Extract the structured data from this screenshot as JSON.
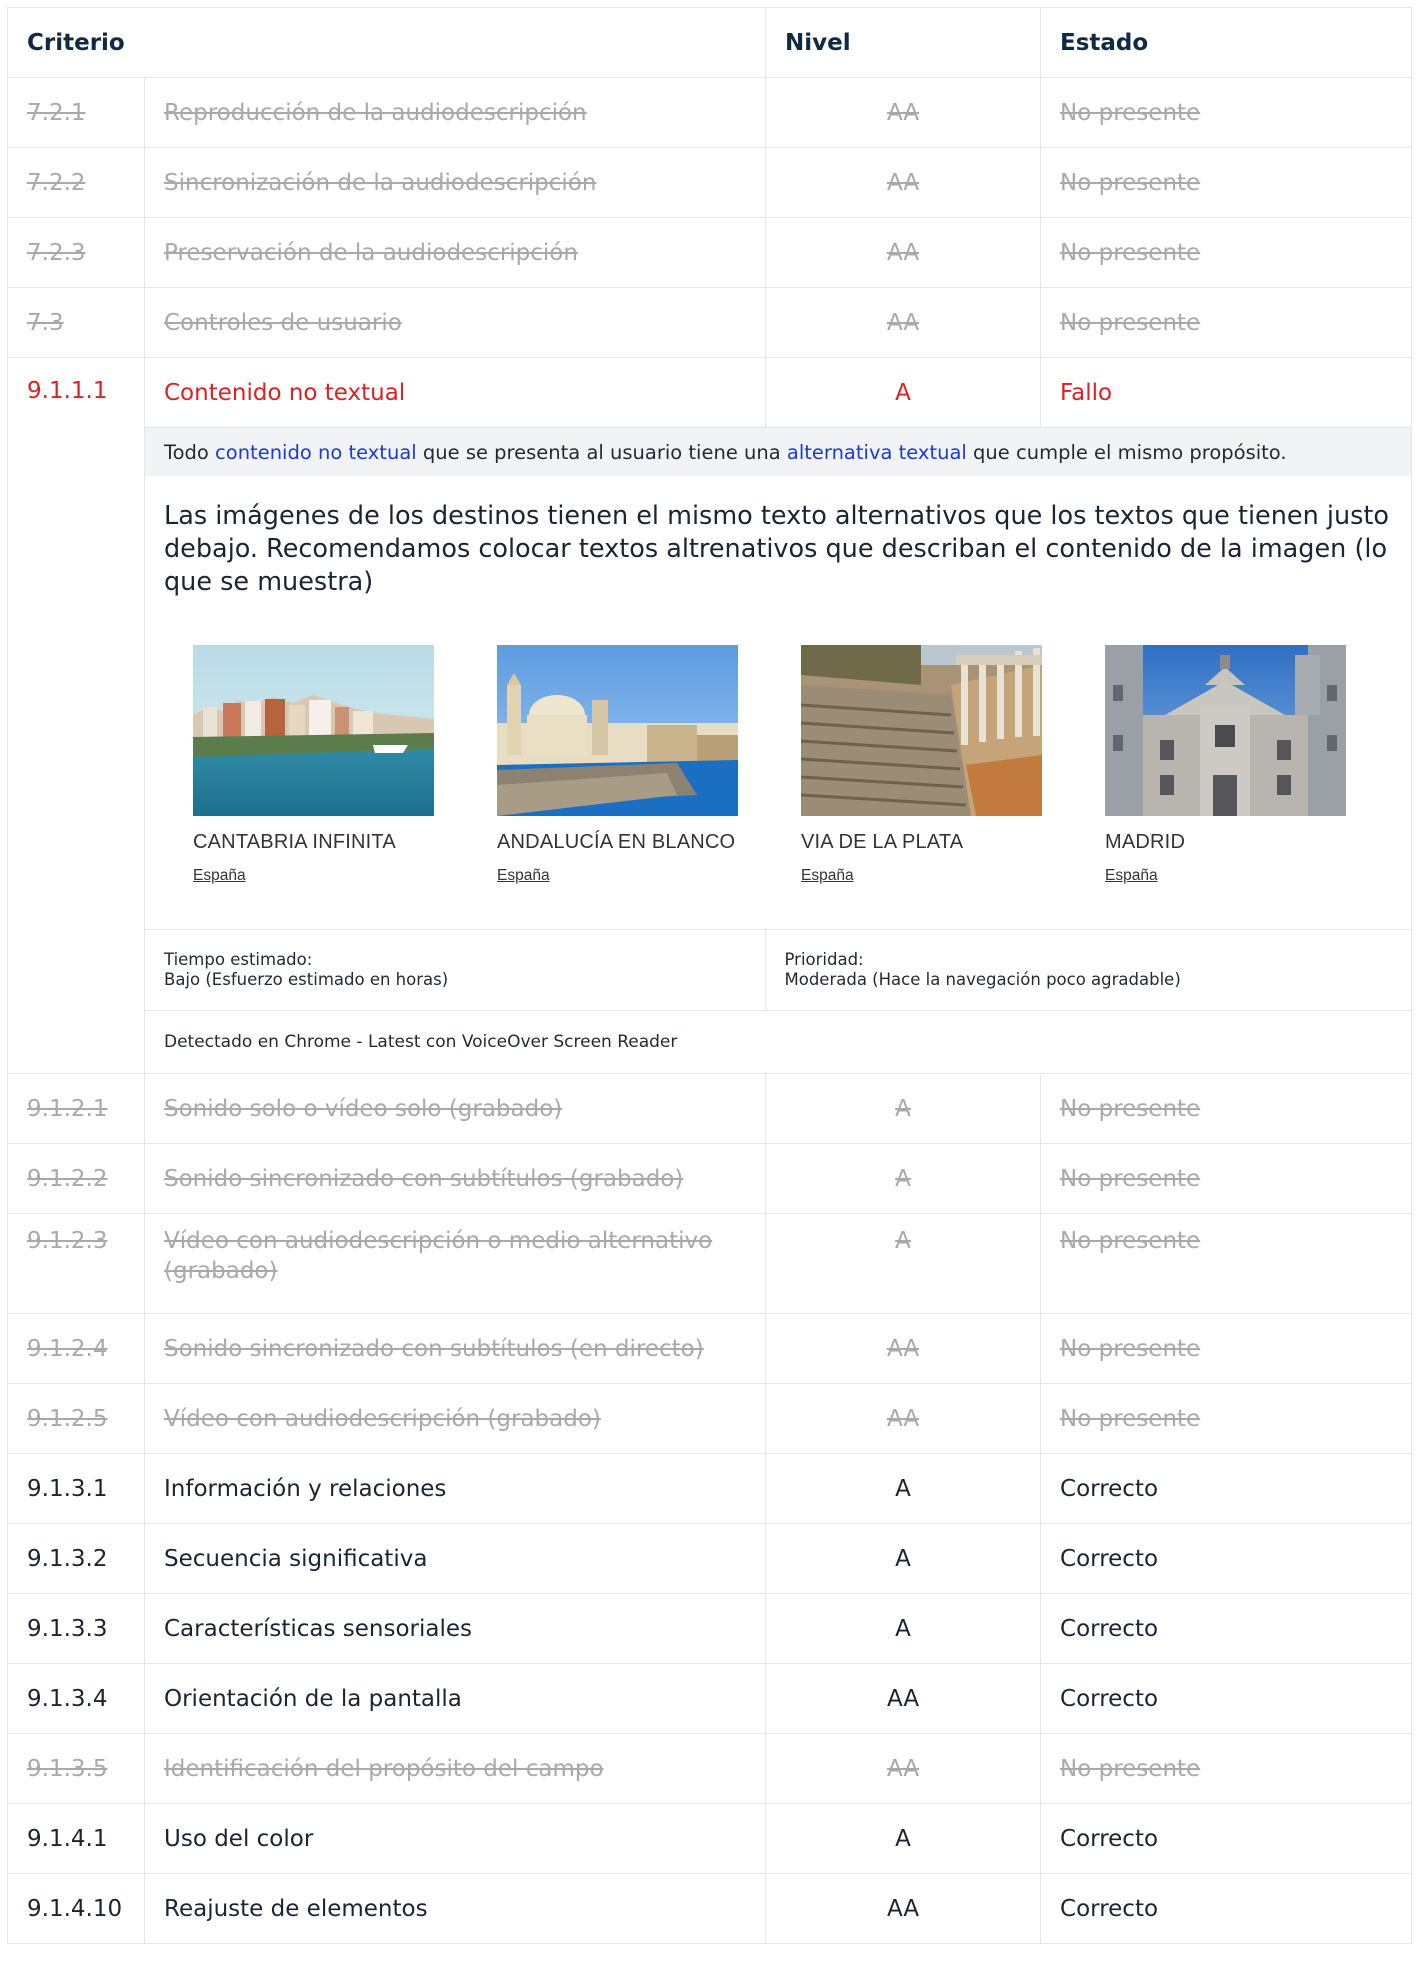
{
  "header": {
    "criterio": "Criterio",
    "nivel": "Nivel",
    "estado": "Estado"
  },
  "rows_top": [
    {
      "id": "7.2.1",
      "name": "Reproducción de la audiodescripción",
      "level": "AA",
      "status": "No presente"
    },
    {
      "id": "7.2.2",
      "name": "Sincronización de la audiodescripción",
      "level": "AA",
      "status": "No presente"
    },
    {
      "id": "7.2.3",
      "name": "Preservación de la audiodescripción",
      "level": "AA",
      "status": "No presente"
    },
    {
      "id": "7.3",
      "name": "Controles de usuario",
      "level": "AA",
      "status": "No presente"
    }
  ],
  "fail_row": {
    "id": "9.1.1.1",
    "name": "Contenido no textual",
    "level": "A",
    "status": "Fallo"
  },
  "fail_detail": {
    "desc_pre": "Todo ",
    "desc_link1": "contenido no textual",
    "desc_mid": " que se presenta al usuario tiene una ",
    "desc_link2": "alternativa textual",
    "desc_post": " que cumple el mismo propósito.",
    "notes": "Las imágenes de los destinos tienen el mismo texto alternativos que los textos que tienen justo debajo. Recomendamos colocar textos altrenativos que describan el contenido de la imagen (lo que se muestra)",
    "cards": [
      {
        "title": "CANTABRIA INFINITA",
        "sub": "España"
      },
      {
        "title": "ANDALUCÍA EN BLANCO",
        "sub": "España"
      },
      {
        "title": "VIA DE LA PLATA",
        "sub": "España"
      },
      {
        "title": "MADRID",
        "sub": "España"
      }
    ],
    "time_label": "Tiempo estimado:",
    "time_value": "Bajo (Esfuerzo estimado en horas)",
    "priority_label": "Prioridad:",
    "priority_value": "Moderada (Hace la navegación poco agradable)",
    "detected": "Detectado en Chrome - Latest con VoiceOver Screen Reader"
  },
  "rows_bottom": [
    {
      "id": "9.1.2.1",
      "name": "Sonido solo o vídeo solo (grabado)",
      "level": "A",
      "status": "No presente",
      "na": true
    },
    {
      "id": "9.1.2.2",
      "name": "Sonido sincronizado con subtítulos (grabado)",
      "level": "A",
      "status": "No presente",
      "na": true
    },
    {
      "id": "9.1.2.3",
      "name": "Vídeo con audiodescripción o medio alternativo (grabado)",
      "level": "A",
      "status": "No presente",
      "na": true
    },
    {
      "id": "9.1.2.4",
      "name": "Sonido sincronizado con subtítulos (en directo)",
      "level": "AA",
      "status": "No presente",
      "na": true
    },
    {
      "id": "9.1.2.5",
      "name": "Vídeo con audiodescripción (grabado)",
      "level": "AA",
      "status": "No presente",
      "na": true
    },
    {
      "id": "9.1.3.1",
      "name": "Información y relaciones",
      "level": "A",
      "status": "Correcto",
      "na": false
    },
    {
      "id": "9.1.3.2",
      "name": "Secuencia significativa",
      "level": "A",
      "status": "Correcto",
      "na": false
    },
    {
      "id": "9.1.3.3",
      "name": "Características sensoriales",
      "level": "A",
      "status": "Correcto",
      "na": false
    },
    {
      "id": "9.1.3.4",
      "name": "Orientación de la pantalla",
      "level": "AA",
      "status": "Correcto",
      "na": false
    },
    {
      "id": "9.1.3.5",
      "name": "Identificación del propósito del campo",
      "level": "AA",
      "status": "No presente",
      "na": true
    },
    {
      "id": "9.1.4.1",
      "name": "Uso del color",
      "level": "A",
      "status": "Correcto",
      "na": false
    },
    {
      "id": "9.1.4.10",
      "name": "Reajuste de elementos",
      "level": "AA",
      "status": "Correcto",
      "na": false
    }
  ],
  "colors": {
    "fail": "#e01e24",
    "link": "#1d39d6",
    "muted": "#a9a9a9",
    "border": "#e4e6ea"
  }
}
